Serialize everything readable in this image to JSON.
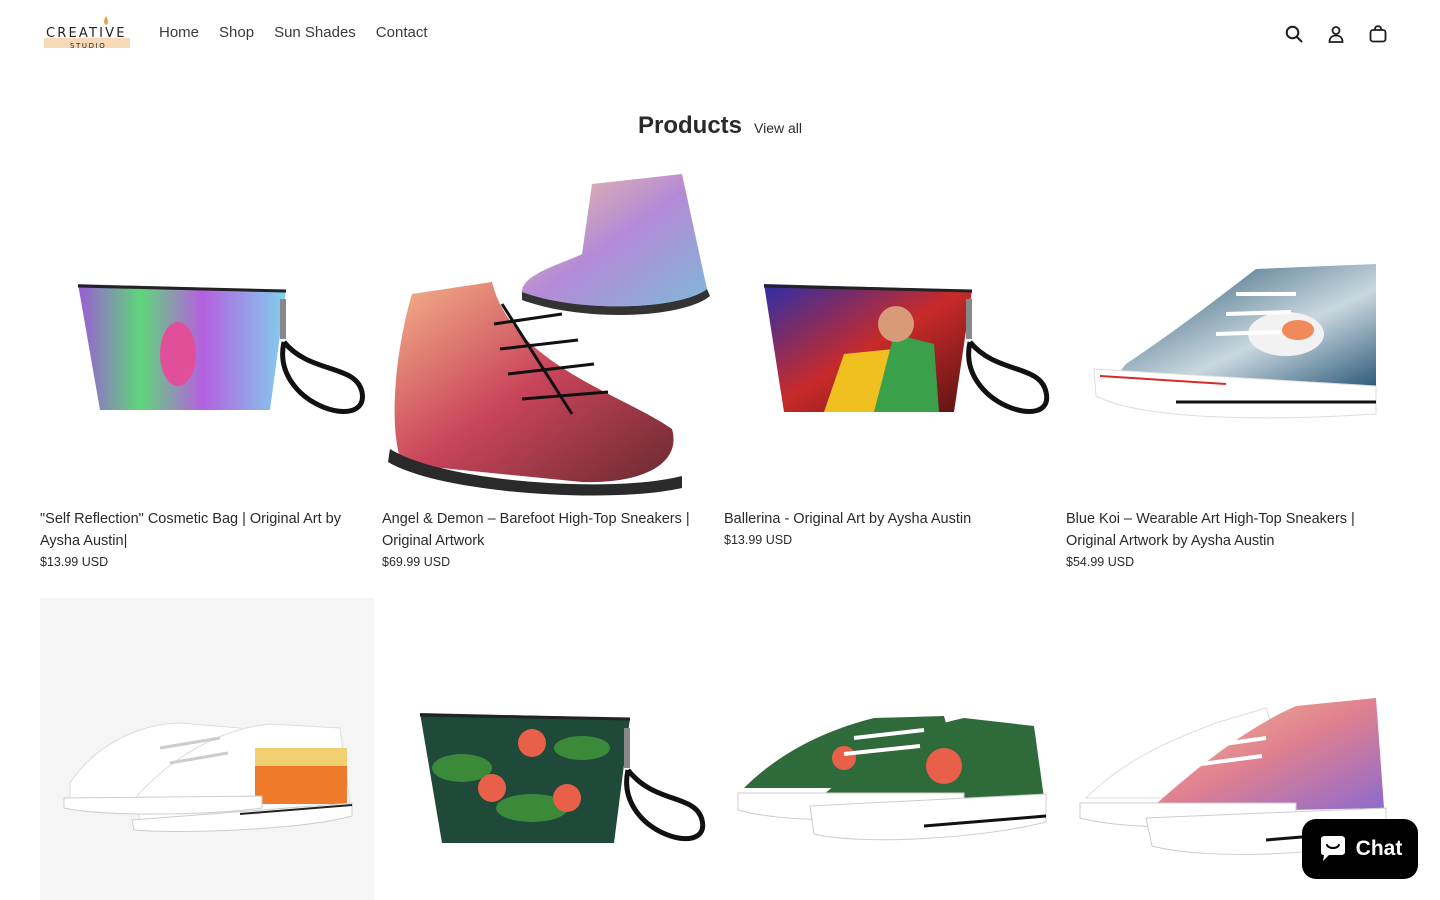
{
  "brand": {
    "name": "CREATIVE",
    "sub": "STUDIO",
    "accent": "#f09a4a"
  },
  "nav": {
    "items": [
      "Home",
      "Shop",
      "Sun Shades",
      "Contact"
    ]
  },
  "header_icons": [
    "search-icon",
    "account-icon",
    "cart-icon"
  ],
  "section": {
    "title": "Products",
    "view_all": "View all"
  },
  "products": [
    {
      "title": "\"Self Reflection\" Cosmetic Bag | Original Art by Aysha Austin|",
      "price": "$13.99 USD"
    },
    {
      "title": "Angel & Demon – Barefoot High-Top Sneakers | Original Artwork",
      "price": "$69.99 USD"
    },
    {
      "title": "Ballerina - Original Art by Aysha Austin",
      "price": "$13.99 USD"
    },
    {
      "title": "Blue Koi – Wearable Art High-Top Sneakers | Original Artwork by Aysha Austin",
      "price": "$54.99 USD"
    }
  ],
  "chat": {
    "label": "Chat"
  }
}
